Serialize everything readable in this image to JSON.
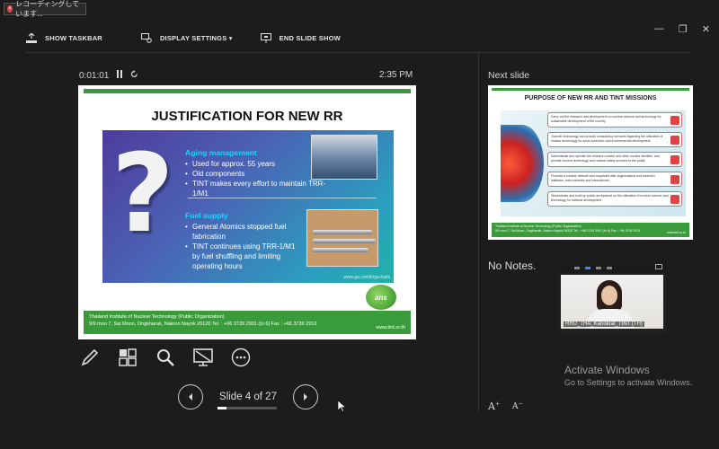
{
  "recording_badge": {
    "text": "レコーディングしています..."
  },
  "window_controls": {
    "minimize": "—",
    "restore": "❐",
    "close": "✕"
  },
  "toolbar": {
    "show_taskbar": "SHOW TASKBAR",
    "display_settings": "DISPLAY SETTINGS ▾",
    "end_slide_show": "END SLIDE SHOW"
  },
  "timer": {
    "elapsed": "0:01:01",
    "clock": "2:35 PM"
  },
  "current_slide": {
    "title": "JUSTIFICATION FOR NEW RR",
    "aging_head": "Aging management",
    "aging_items": [
      "Used for approx. 55 years",
      "Old components",
      "TINT makes every effort to maintain TRR-1/M1"
    ],
    "fuel_head": "Fuel supply",
    "fuel_items": [
      "General Atomics stopped fuel fabrication",
      "TINT continues using TRR-1/M1 by fuel shuffling and limiting operating hours"
    ],
    "panel_url": "www.ga.com/triga-fuels",
    "logo_text": "ans",
    "footer_line1": "Thailand Institute of Nuclear Technology (Public Organization)",
    "footer_line2": "9/9 moo 7, Sai Moon, Ongkharak, Nakorn Nayok 26120 Tel. : +66 3739 2901 (to 6) Fax : +66 3739 2913",
    "footer_url": "www.tint.or.th"
  },
  "navigation": {
    "slide_counter": "Slide 4 of 27",
    "progress": 0.148
  },
  "next_slide": {
    "label": "Next slide",
    "title": "PURPOSE OF NEW RR AND TINT MISSIONS",
    "rows": [
      "Carry out the research and development on nuclear science and technology for sustainable development of the country",
      "Transfer technology and provide consultancy services regarding the utilization of nuclear technology for socio-economic and environmental development",
      "Administrate and operate the research reactor and other nuclear facilities, and provide nuclear technology and nuclear safety services to the public",
      "Promote a nuclear network and cooperate with organizations and research institutes, both domestic and international",
      "Disseminate and build up public acceptance on the utilization of nuclear science and technology for national development"
    ],
    "footer_line1": "Thailand Institute of Nuclear Technology (Public Organization)",
    "footer_line2": "9/9 moo 7, Sai Moon, Ongkharak, Nakorn Nayok 26120 Tel. : +66 3739 2901 (to 6) Fax : +66 3739 2913",
    "footer_url": "www.tint.or.th"
  },
  "notes": {
    "text": "No Notes."
  },
  "video": {
    "participant_name": "RRU_THA_Kanokrat_TINT (TH)"
  },
  "watermark": {
    "title": "Activate Windows",
    "subtitle": "Go to Settings to activate Windows."
  },
  "font_buttons": {
    "increase": "A",
    "decrease": "A"
  }
}
